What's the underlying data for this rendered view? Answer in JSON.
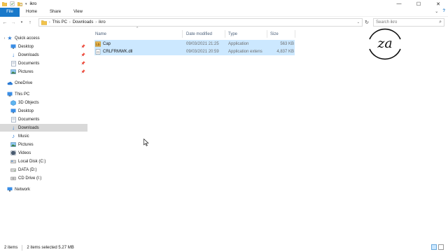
{
  "window": {
    "title": "ikro",
    "quick_access_icons": [
      "folder-icon",
      "properties-icon",
      "new-folder-icon"
    ],
    "controls": {
      "minimize": "—",
      "maximize": "☐",
      "close": "✕"
    }
  },
  "ribbon": {
    "tabs": [
      "File",
      "Home",
      "Share",
      "View"
    ],
    "active_tab": "File",
    "right_controls": {
      "collapse": "⌄",
      "help": "?"
    }
  },
  "address": {
    "breadcrumbs": [
      "This PC",
      "Downloads",
      "ikro"
    ],
    "search_placeholder": "Search ikro",
    "nav_icons": [
      "back-arrow-icon",
      "forward-arrow-icon",
      "recent-dropdown-icon",
      "up-arrow-icon"
    ]
  },
  "navpane": {
    "items": [
      {
        "label": "Quick access",
        "icon": "star-icon",
        "level": 0,
        "pinned": false
      },
      {
        "label": "Desktop",
        "icon": "desktop-icon",
        "level": 1,
        "pinned": true
      },
      {
        "label": "Downloads",
        "icon": "download-icon",
        "level": 1,
        "pinned": true
      },
      {
        "label": "Documents",
        "icon": "documents-icon",
        "level": 1,
        "pinned": true
      },
      {
        "label": "Pictures",
        "icon": "pictures-icon",
        "level": 1,
        "pinned": true
      },
      {
        "label": "OneDrive",
        "icon": "cloud-icon",
        "level": 0,
        "pinned": false
      },
      {
        "label": "This PC",
        "icon": "computer-icon",
        "level": 0,
        "pinned": false
      },
      {
        "label": "3D Objects",
        "icon": "cube-icon",
        "level": 1,
        "pinned": false
      },
      {
        "label": "Desktop",
        "icon": "desktop-icon",
        "level": 1,
        "pinned": false
      },
      {
        "label": "Documents",
        "icon": "documents-icon",
        "level": 1,
        "pinned": false
      },
      {
        "label": "Downloads",
        "icon": "download-icon",
        "level": 1,
        "pinned": false,
        "selected": true
      },
      {
        "label": "Music",
        "icon": "music-icon",
        "level": 1,
        "pinned": false
      },
      {
        "label": "Pictures",
        "icon": "pictures-icon",
        "level": 1,
        "pinned": false
      },
      {
        "label": "Videos",
        "icon": "video-icon",
        "level": 1,
        "pinned": false
      },
      {
        "label": "Local Disk (C:)",
        "icon": "drive-icon",
        "level": 1,
        "pinned": false
      },
      {
        "label": "DATA (D:)",
        "icon": "drive-icon",
        "level": 1,
        "pinned": false
      },
      {
        "label": "CD Drive (I:)",
        "icon": "cd-drive-icon",
        "level": 1,
        "pinned": false
      },
      {
        "label": "Network",
        "icon": "network-icon",
        "level": 0,
        "pinned": false
      }
    ]
  },
  "filelist": {
    "columns": [
      "Name",
      "Date modified",
      "Type",
      "Size"
    ],
    "sort_column": "Name",
    "rows": [
      {
        "name": "Cap",
        "date": "09/03/2021 21:25",
        "type": "Application",
        "size": "563 KB",
        "icon": "application-icon",
        "selected": true
      },
      {
        "name": "CRLFRMWK.dll",
        "date": "09/03/2021 20:59",
        "type": "Application extens",
        "size": "4,837 KB",
        "icon": "dll-file-icon",
        "selected": true
      }
    ]
  },
  "watermark_logo": {
    "text": "za"
  },
  "status": {
    "item_count": "2 items",
    "selection": "2 items selected  5.27 MB"
  },
  "colors": {
    "accent": "#1979ca",
    "selection": "#cce8ff",
    "nav_selected": "#d9d9d9",
    "column_header": "#4c607a"
  }
}
